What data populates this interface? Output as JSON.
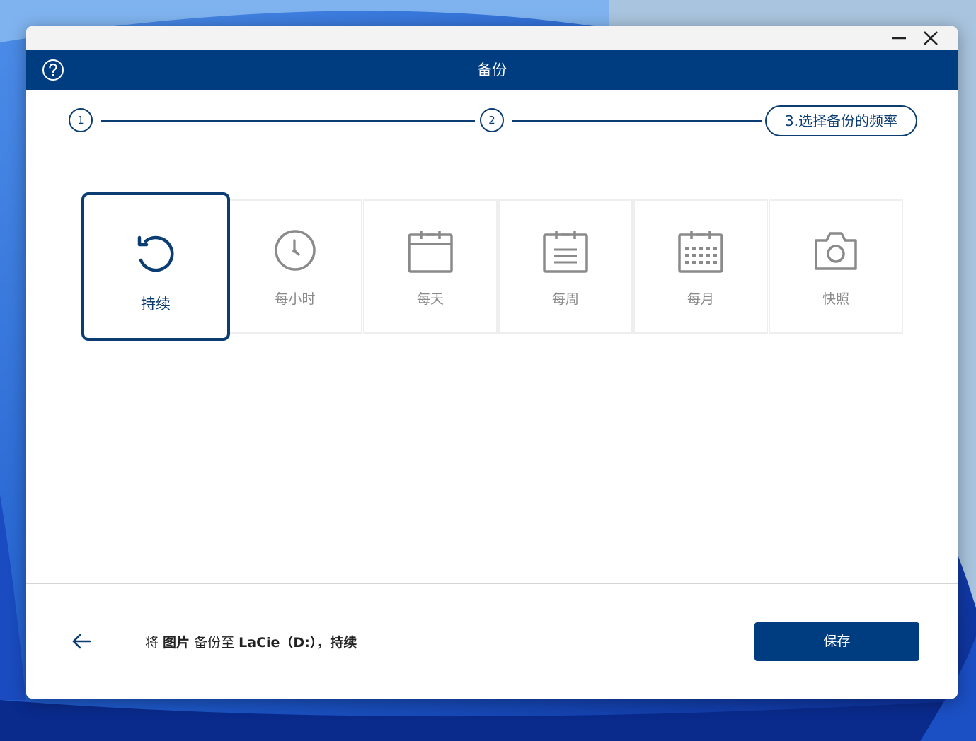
{
  "window": {
    "title": "备份"
  },
  "stepper": {
    "step1": "1",
    "step2": "2",
    "current_step_label": "3.选择备份的频率"
  },
  "options": [
    {
      "label": "持续",
      "icon": "continuous-icon",
      "selected": true
    },
    {
      "label": "每小时",
      "icon": "clock-icon",
      "selected": false
    },
    {
      "label": "每天",
      "icon": "calendar-day-icon",
      "selected": false
    },
    {
      "label": "每周",
      "icon": "calendar-week-icon",
      "selected": false
    },
    {
      "label": "每月",
      "icon": "calendar-month-icon",
      "selected": false
    },
    {
      "label": "快照",
      "icon": "camera-icon",
      "selected": false
    }
  ],
  "footer": {
    "summary_prefix": "将 ",
    "summary_source": "图片",
    "summary_middle": " 备份至 ",
    "summary_target": "LaCie（D:）",
    "summary_sep": "，",
    "summary_frequency": "持续",
    "save_label": "保存"
  },
  "colors": {
    "primary": "#003c80",
    "step_outline": "#0b3d73",
    "inactive_icon": "#8a8a8a",
    "divider": "#d4d4d4"
  }
}
